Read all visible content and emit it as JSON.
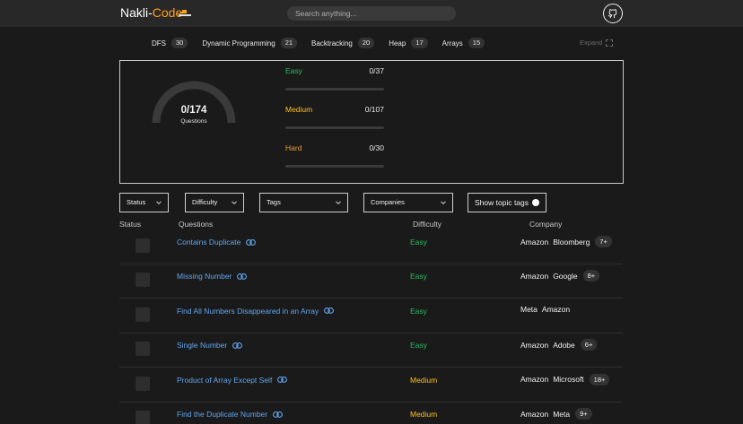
{
  "header": {
    "logo_prefix": "Nakli-",
    "logo_accent": "Code",
    "search_placeholder": "Search anything...",
    "github_icon": "github-icon"
  },
  "topic_tags": [
    {
      "label": "DFS",
      "count": "30"
    },
    {
      "label": "Dynamic Programming",
      "count": "21"
    },
    {
      "label": "Backtracking",
      "count": "20"
    },
    {
      "label": "Heap",
      "count": "17"
    },
    {
      "label": "Arrays",
      "count": "15"
    }
  ],
  "expand_label": "Expand",
  "progress": {
    "total": "0/174",
    "total_label": "Questions",
    "solved_fraction": 0,
    "difficulties": [
      {
        "name": "Easy",
        "value": "0/37",
        "fraction": 0
      },
      {
        "name": "Medium",
        "value": "0/107",
        "fraction": 0
      },
      {
        "name": "Hard",
        "value": "0/30",
        "fraction": 0
      }
    ]
  },
  "filters": {
    "status": "Status",
    "difficulty": "Difficulty",
    "tags": "Tags",
    "companies": "Companies",
    "show_topic_tags": "Show topic tags"
  },
  "table": {
    "headers": {
      "status": "Status",
      "questions": "Questions",
      "difficulty": "Difficulty",
      "company": "Company"
    },
    "rows": [
      {
        "title": "Contains Duplicate",
        "difficulty": "Easy",
        "companies": [
          "Amazon",
          "Bloomberg"
        ],
        "more": "7+"
      },
      {
        "title": "Missing Number",
        "difficulty": "Easy",
        "companies": [
          "Amazon",
          "Google"
        ],
        "more": "8+"
      },
      {
        "title": "Find All Numbers Disappeared in an Array",
        "difficulty": "Easy",
        "companies": [
          "Meta",
          "Amazon"
        ],
        "more": ""
      },
      {
        "title": "Single Number",
        "difficulty": "Easy",
        "companies": [
          "Amazon",
          "Adobe"
        ],
        "more": "6+"
      },
      {
        "title": "Product of Array Except Self",
        "difficulty": "Medium",
        "companies": [
          "Amazon",
          "Microsoft"
        ],
        "more": "18+"
      },
      {
        "title": "Find the Duplicate Number",
        "difficulty": "Medium",
        "companies": [
          "Amazon",
          "Meta"
        ],
        "more": "9+"
      }
    ]
  },
  "colors": {
    "accent": "#ffa116",
    "easy": "#2cbb5d",
    "medium": "#ffc01e",
    "hard": "#ef9b3a",
    "link": "#62a6f0",
    "background": "#1a1a1a",
    "topbar": "#282828"
  }
}
